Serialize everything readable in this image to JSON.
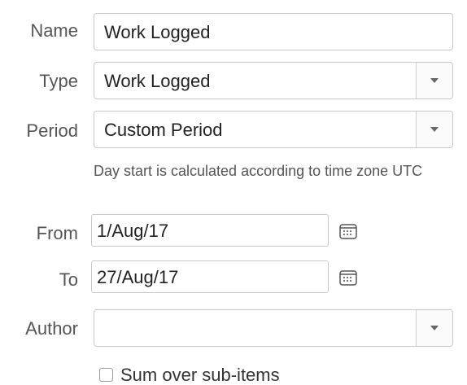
{
  "form": {
    "name": {
      "label": "Name",
      "value": "Work Logged"
    },
    "type": {
      "label": "Type",
      "value": "Work Logged"
    },
    "period": {
      "label": "Period",
      "value": "Custom Period",
      "hint": "Day start is calculated according to time zone UTC"
    },
    "from": {
      "label": "From",
      "value": "1/Aug/17"
    },
    "to": {
      "label": "To",
      "value": "27/Aug/17"
    },
    "author": {
      "label": "Author",
      "value": ""
    },
    "sum_over_subitems": {
      "label": "Sum over sub-items",
      "checked": false
    }
  },
  "icons": {
    "dropdown": "chevron-down-icon",
    "calendar": "calendar-icon"
  },
  "colors": {
    "border": "#c8c8c8",
    "label": "#555555",
    "text": "#222222"
  }
}
